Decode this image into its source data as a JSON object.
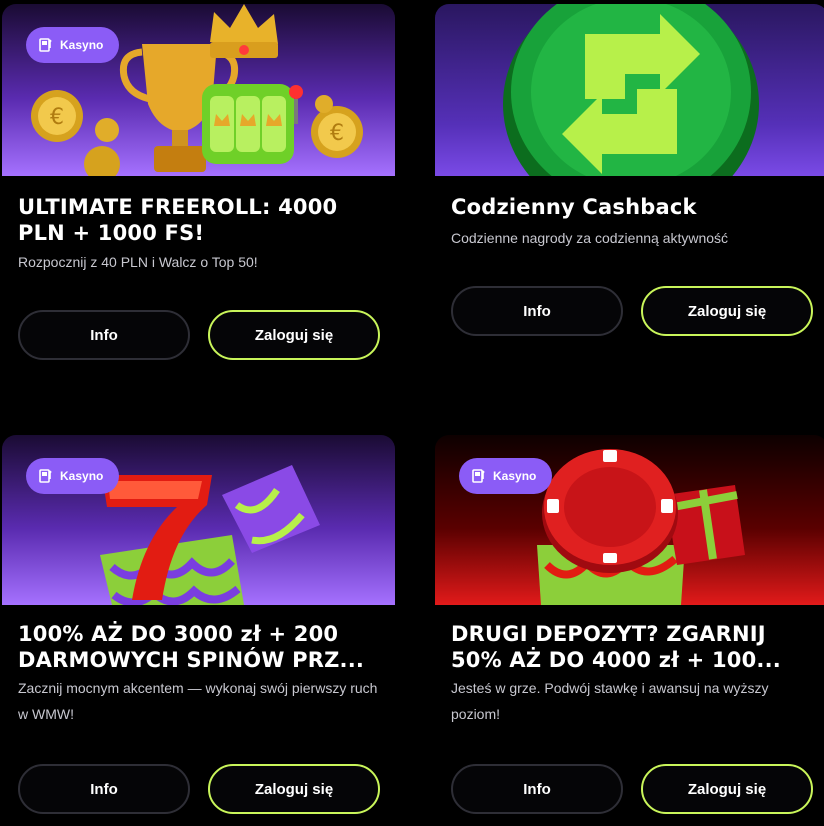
{
  "cards": [
    {
      "badge": "Kasyno",
      "title": "ULTIMATE FREEROLL: 4000 PLN + 1000 FS!",
      "description": "Rozpocznij z 40 PLN i Walcz o Top 50!",
      "info_label": "Info",
      "login_label": "Zaloguj się"
    },
    {
      "badge": "",
      "title": "Codzienny Cashback",
      "description": "Codzienne nagrody za codzienną aktywność",
      "info_label": "Info",
      "login_label": "Zaloguj się"
    },
    {
      "badge": "Kasyno",
      "title": "100% AŻ DO 3000 zł + 200 DARMOWYCH SPINÓW PRZ...",
      "description": "Zacznij mocnym akcentem — wykonaj swój pierwszy ruch w WMW!",
      "info_label": "Info",
      "login_label": "Zaloguj się"
    },
    {
      "badge": "Kasyno",
      "title": "DRUGI DEPOZYT? ZGARNIJ 50% AŻ DO 4000 zł + 100...",
      "description": "Jesteś w grze. Podwój stawkę i awansuj na wyższy poziom!",
      "info_label": "Info",
      "login_label": "Zaloguj się"
    }
  ],
  "colors": {
    "background": "#000000",
    "badge": "#8b5cf6",
    "login_border": "#c9f55a",
    "info_border": "#2e2e36"
  },
  "icons": [
    "casino-icon",
    "trophy-image",
    "crown-image",
    "slot-machine-image",
    "coin-image",
    "cashback-coin-image",
    "lucky-seven-image",
    "gift-box-image",
    "poker-chip-image"
  ]
}
